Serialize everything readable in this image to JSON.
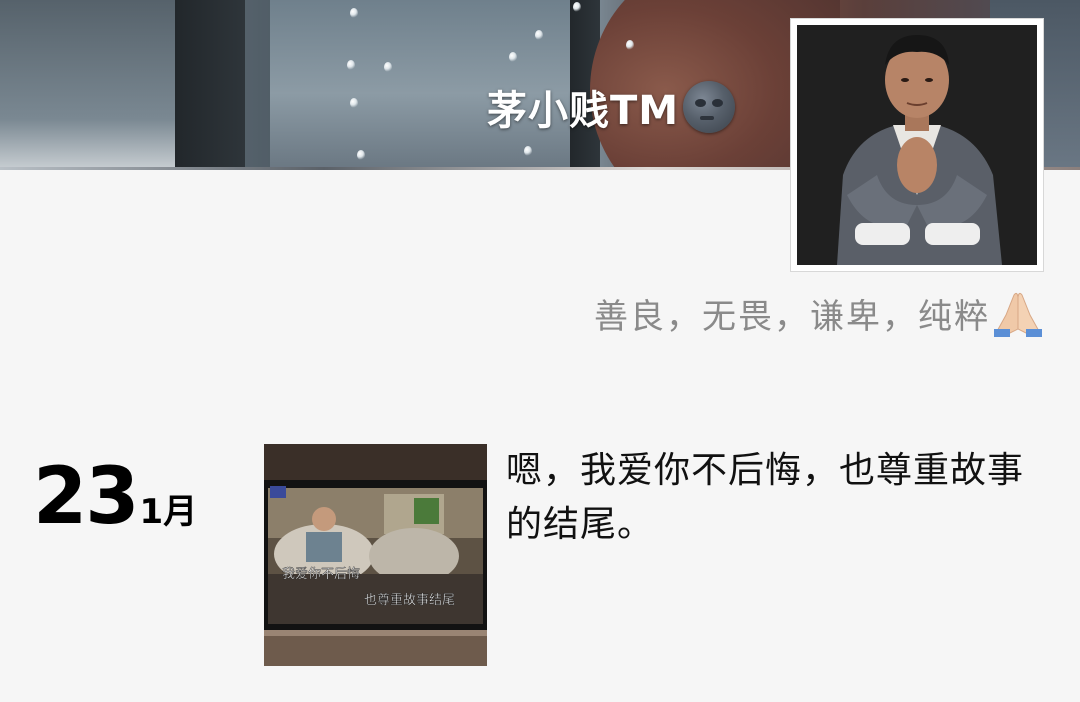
{
  "profile": {
    "nickname": "茅小贱TM",
    "nickname_emoji": "new-moon-face-icon",
    "signature": "善良，无畏，谦卑，纯粹",
    "signature_emoji": "folded-hands-icon"
  },
  "posts": [
    {
      "day": "23",
      "month": "1月",
      "thumbnail_caption_line1": "我爱你不后悔",
      "thumbnail_caption_line2": "也尊重故事结尾",
      "text": "嗯，我爱你不后悔，也尊重故事的结尾。"
    }
  ]
}
